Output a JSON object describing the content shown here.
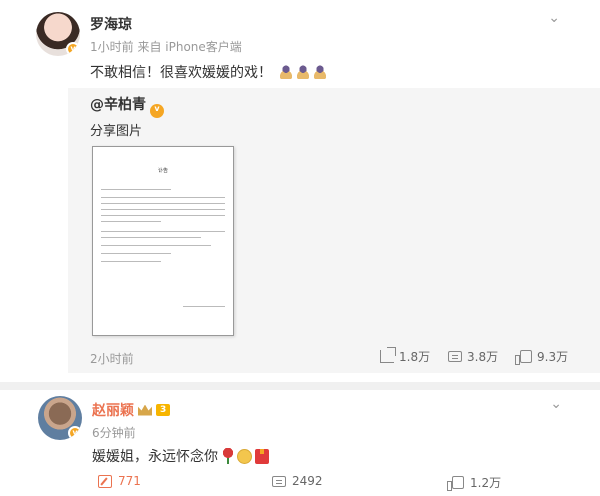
{
  "post": {
    "author": "罗海琼",
    "meta": "1小时前 来自 iPhone客户端",
    "text": "不敢相信！很喜欢媛媛的戏！",
    "repost": {
      "author": "@辛柏青",
      "text": "分享图片",
      "doc_title": "讣告",
      "time": "2小时前",
      "stats": {
        "shares": "1.8万",
        "comments": "3.8万",
        "likes": "9.3万"
      }
    }
  },
  "comment": {
    "author": "赵丽颖",
    "level": "3",
    "meta": "6分钟前",
    "text": "媛媛姐，永远怀念你",
    "stats": {
      "shares": "771",
      "comments": "2492",
      "likes": "1.2万"
    }
  },
  "colors": {
    "accent": "#eb7350",
    "badge": "#f5a623",
    "repost_bg": "#f5f5f5"
  }
}
